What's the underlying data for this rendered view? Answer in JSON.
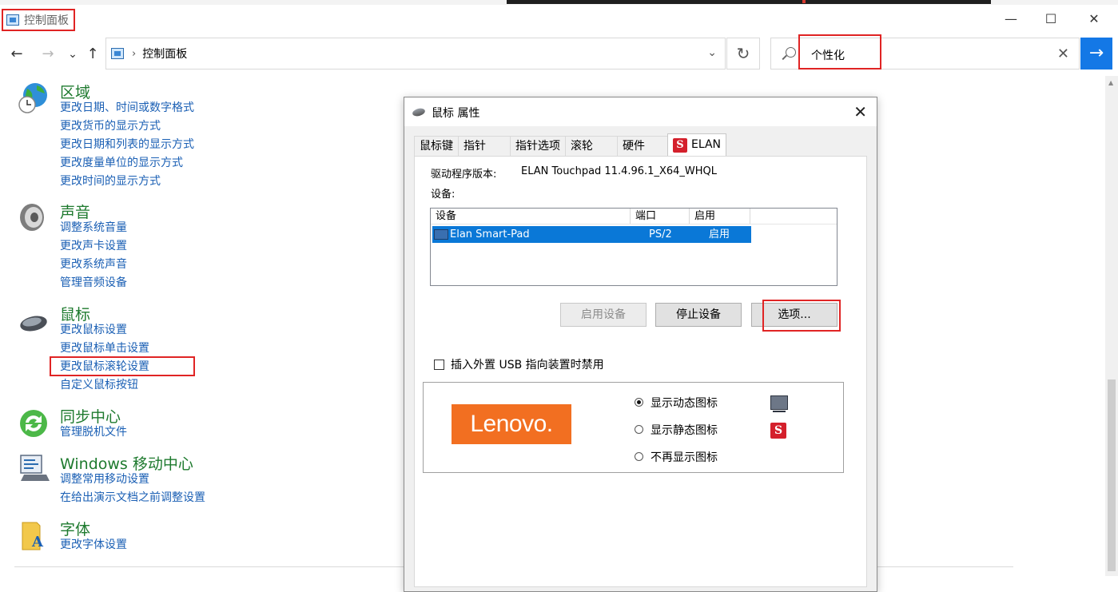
{
  "window": {
    "title": "控制面板",
    "minimize_glyph": "—",
    "maximize_glyph": "☐",
    "close_glyph": "✕"
  },
  "address": {
    "back_glyph": "←",
    "forward_glyph": "→",
    "recent_glyph": "⌄",
    "up_glyph": "↑",
    "separator": "›",
    "path": "控制面板",
    "dropdown_glyph": "⌄",
    "refresh_glyph": "↻"
  },
  "search": {
    "value": "个性化",
    "clear_glyph": "✕",
    "go_glyph": "→"
  },
  "categories": {
    "region": {
      "title": "区域",
      "links": [
        "更改日期、时间或数字格式",
        "更改货币的显示方式",
        "更改日期和列表的显示方式",
        "更改度量单位的显示方式",
        "更改时间的显示方式"
      ]
    },
    "sound": {
      "title": "声音",
      "links": [
        "调整系统音量",
        "更改声卡设置",
        "更改系统声音",
        "管理音频设备"
      ]
    },
    "mouse": {
      "title": "鼠标",
      "links": [
        "更改鼠标设置",
        "更改鼠标单击设置",
        "更改鼠标滚轮设置",
        "自定义鼠标按钮"
      ]
    },
    "sync": {
      "title": "同步中心",
      "links": [
        "管理脱机文件"
      ]
    },
    "mobility": {
      "title": "Windows 移动中心",
      "links": [
        "调整常用移动设置",
        "在给出演示文档之前调整设置"
      ]
    },
    "fonts": {
      "title": "字体",
      "links": [
        "更改字体设置"
      ]
    }
  },
  "dialog": {
    "title": "鼠标 属性",
    "close_glyph": "✕",
    "tabs": [
      "鼠标键",
      "指针",
      "指针选项",
      "滚轮",
      "硬件",
      "ELAN"
    ],
    "elan_badge": "S",
    "driver_label": "驱动程序版本:",
    "driver_value": "ELAN Touchpad 11.4.96.1_X64_WHQL",
    "devices_label": "设备:",
    "columns": [
      "设备",
      "端口",
      "启用"
    ],
    "device_row": {
      "name": "Elan Smart-Pad",
      "port": "PS/2",
      "enabled": "启用"
    },
    "buttons": {
      "enable": "启用设备",
      "disable": "停止设备",
      "options": "选项..."
    },
    "checkbox_label": "插入外置 USB 指向装置时禁用",
    "logo_text": "Lenovo.",
    "radios": [
      {
        "label": "显示动态图标",
        "checked": true
      },
      {
        "label": "显示静态图标",
        "checked": false
      },
      {
        "label": "不再显示图标",
        "checked": false
      }
    ]
  },
  "colors": {
    "category_title": "#1e7a2e",
    "link": "#1a5fb4",
    "highlight_box": "#e02424",
    "selection": "#0a78d7",
    "search_button": "#1478e6",
    "lenovo": "#f26f21",
    "elan_red": "#d4202c"
  }
}
